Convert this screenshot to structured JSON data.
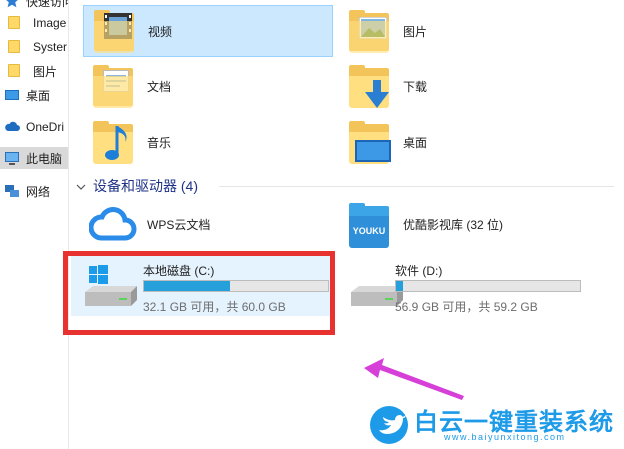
{
  "sidebar": {
    "items": [
      {
        "label": "快速访问"
      },
      {
        "label": "Image"
      },
      {
        "label": "Syster"
      },
      {
        "label": "图片"
      },
      {
        "label": "桌面"
      },
      {
        "label": "OneDri"
      },
      {
        "label": "此电脑"
      },
      {
        "label": "网络"
      }
    ]
  },
  "folders": [
    {
      "label": "视频"
    },
    {
      "label": "图片"
    },
    {
      "label": "文档"
    },
    {
      "label": "下载"
    },
    {
      "label": "音乐"
    },
    {
      "label": "桌面"
    }
  ],
  "section": {
    "title": "设备和驱动器 (4)"
  },
  "devices": [
    {
      "label": "WPS云文档"
    },
    {
      "label": "优酷影视库 (32 位)",
      "logo_text": "YOUKU"
    }
  ],
  "drives": [
    {
      "name": "本地磁盘 (C:)",
      "space": "32.1 GB 可用，共 60.0 GB",
      "used_fraction": 0.465
    },
    {
      "name": "软件 (D:)",
      "space": "56.9 GB 可用，共 59.2 GB",
      "used_fraction": 0.04
    }
  ],
  "watermark": {
    "title": "白云一键重装系统",
    "url": "www.baiyunxitong.com"
  },
  "colors": {
    "accent": "#26a0da",
    "selection": "#cce8ff",
    "highlight_box": "#e8322f",
    "arrow": "#d63fd8",
    "watermark": "#1e9be8",
    "section_header": "#1e3287"
  }
}
